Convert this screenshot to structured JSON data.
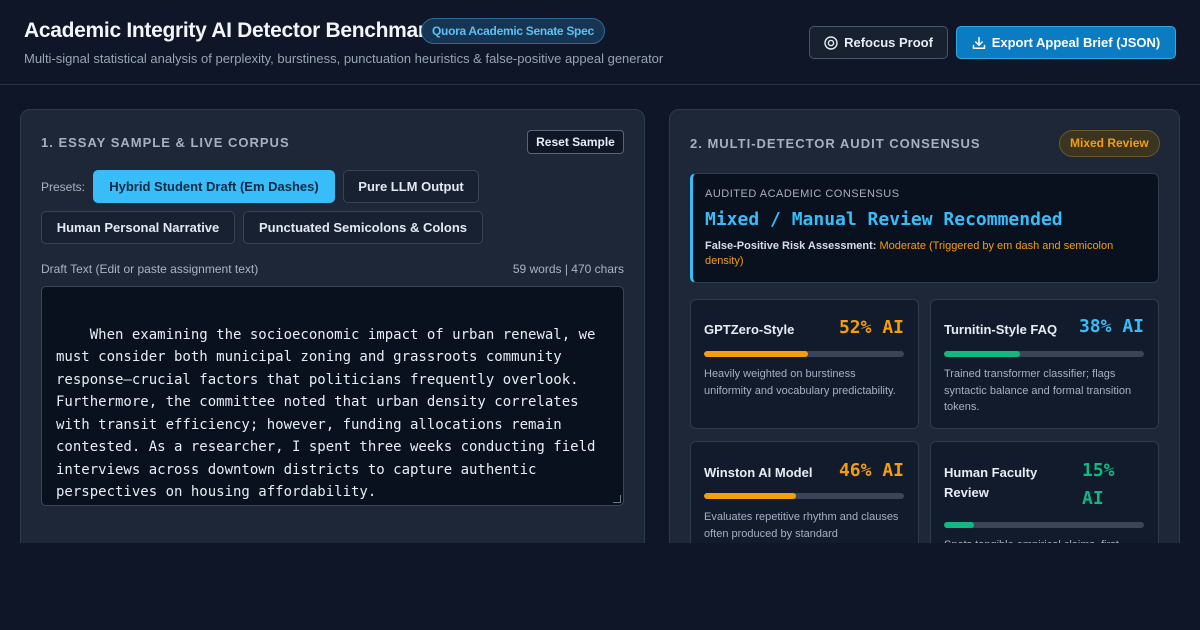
{
  "header": {
    "title": "Academic Integrity AI Detector Benchmark",
    "badge": "Quora Academic Senate Spec",
    "subtitle": "Multi-signal statistical analysis of perplexity, burstiness, punctuation heuristics & false-positive appeal generator",
    "refocus_label": "Refocus Proof",
    "export_label": "Export Appeal Brief (JSON)",
    "refocus_icon": "target-icon",
    "export_icon": "download-icon"
  },
  "left_panel": {
    "heading": "1. ESSAY SAMPLE & LIVE CORPUS",
    "reset_label": "Reset Sample",
    "presets_label": "Presets:",
    "presets": [
      {
        "label": "Hybrid Student Draft (Em Dashes)",
        "active": true
      },
      {
        "label": "Pure LLM Output",
        "active": false
      },
      {
        "label": "Human Personal Narrative",
        "active": false
      },
      {
        "label": "Punctuated Semicolons & Colons",
        "active": false
      }
    ],
    "draft_label": "Draft Text (Edit or paste assignment text)",
    "draft_count": "59 words | 470 chars",
    "draft_text": "When examining the socioeconomic impact of urban renewal, we must consider both municipal zoning and grassroots community response—crucial factors that politicians frequently overlook. Furthermore, the committee noted that urban density correlates with transit efficiency; however, funding allocations remain contested. As a researcher, I spent three weeks conducting field interviews across downtown districts to capture authentic perspectives on housing affordability."
  },
  "right_panel": {
    "heading": "2. MULTI-DETECTOR AUDIT CONSENSUS",
    "status_badge": "Mixed Review",
    "consensus": {
      "label": "AUDITED ACADEMIC CONSENSUS",
      "verdict": "Mixed / Manual Review Recommended",
      "risk_label": "False-Positive Risk Assessment:",
      "risk_value": "Moderate (Triggered by em dash and semicolon density)"
    },
    "detectors": [
      {
        "name": "GPTZero-Style",
        "score": "52% AI",
        "level": 52,
        "color": "#f59e0b",
        "desc": "Heavily weighted on burstiness uniformity and vocabulary predictability."
      },
      {
        "name": "Turnitin-Style FAQ",
        "score": "38% AI",
        "level": 38,
        "color": "#10b981",
        "score_color": "#38bdf8",
        "desc": "Trained transformer classifier; flags syntactic balance and formal transition tokens."
      },
      {
        "name": "Winston AI Model",
        "score": "46% AI",
        "level": 46,
        "color": "#f59e0b",
        "desc": "Evaluates repetitive rhythm and clauses often produced by standard"
      },
      {
        "name": "Human Faculty Review",
        "score": "15% AI",
        "level": 15,
        "color": "#10b981",
        "desc": "Spots tangible empirical claims, first"
      }
    ]
  },
  "colors": {
    "accent": "#38bdf8",
    "warning": "#f59e0b",
    "success": "#10b981",
    "background": "#0e1627",
    "panel": "#1d2738"
  }
}
